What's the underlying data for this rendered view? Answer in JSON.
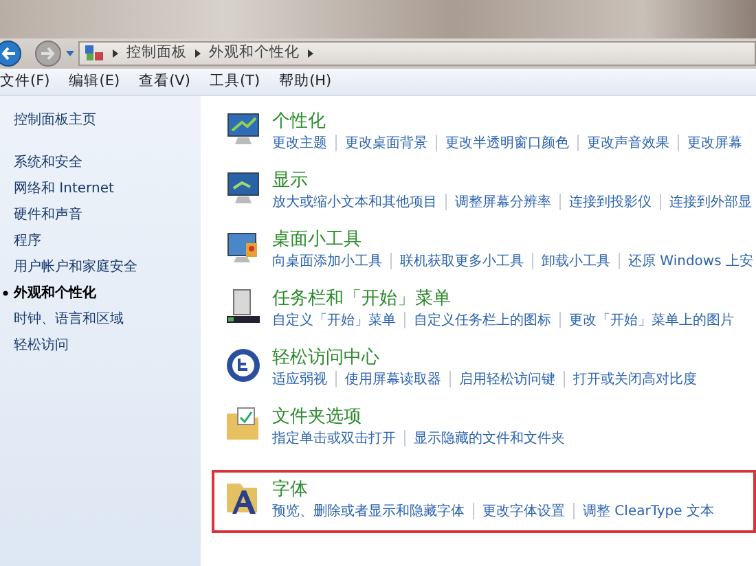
{
  "breadcrumb": [
    "控制面板",
    "外观和个性化"
  ],
  "menu": [
    "文件(F)",
    "编辑(E)",
    "查看(V)",
    "工具(T)",
    "帮助(H)"
  ],
  "sidebar": {
    "home": "控制面板主页",
    "items": [
      {
        "label": "系统和安全",
        "selected": false
      },
      {
        "label": "网络和 Internet",
        "selected": false
      },
      {
        "label": "硬件和声音",
        "selected": false
      },
      {
        "label": "程序",
        "selected": false
      },
      {
        "label": "用户帐户和家庭安全",
        "selected": false
      },
      {
        "label": "外观和个性化",
        "selected": true
      },
      {
        "label": "时钟、语言和区域",
        "selected": false
      },
      {
        "label": "轻松访问",
        "selected": false
      }
    ]
  },
  "categories": [
    {
      "kind": "monitor",
      "title": "个性化",
      "highlighted": false,
      "links": [
        "更改主题",
        "更改桌面背景",
        "更改半透明窗口颜色",
        "更改声音效果",
        "更改屏幕"
      ]
    },
    {
      "kind": "display",
      "title": "显示",
      "highlighted": false,
      "links": [
        "放大或缩小文本和其他项目",
        "调整屏幕分辨率",
        "连接到投影仪",
        "连接到外部显"
      ]
    },
    {
      "kind": "gadget",
      "title": "桌面小工具",
      "highlighted": false,
      "links": [
        "向桌面添加小工具",
        "联机获取更多小工具",
        "卸载小工具",
        "还原 Windows 上安"
      ]
    },
    {
      "kind": "taskbar",
      "title": "任务栏和「开始」菜单",
      "highlighted": false,
      "links": [
        "自定义「开始」菜单",
        "自定义任务栏上的图标",
        "更改「开始」菜单上的图片"
      ]
    },
    {
      "kind": "access",
      "title": "轻松访问中心",
      "highlighted": false,
      "links": [
        "适应弱视",
        "使用屏幕读取器",
        "启用轻松访问键",
        "打开或关闭高对比度"
      ]
    },
    {
      "kind": "folder",
      "title": "文件夹选项",
      "highlighted": false,
      "links": [
        "指定单击或双击打开",
        "显示隐藏的文件和文件夹"
      ]
    },
    {
      "kind": "font",
      "title": "字体",
      "highlighted": true,
      "links": [
        "预览、删除或者显示和隐藏字体",
        "更改字体设置",
        "调整 ClearType 文本"
      ]
    }
  ]
}
